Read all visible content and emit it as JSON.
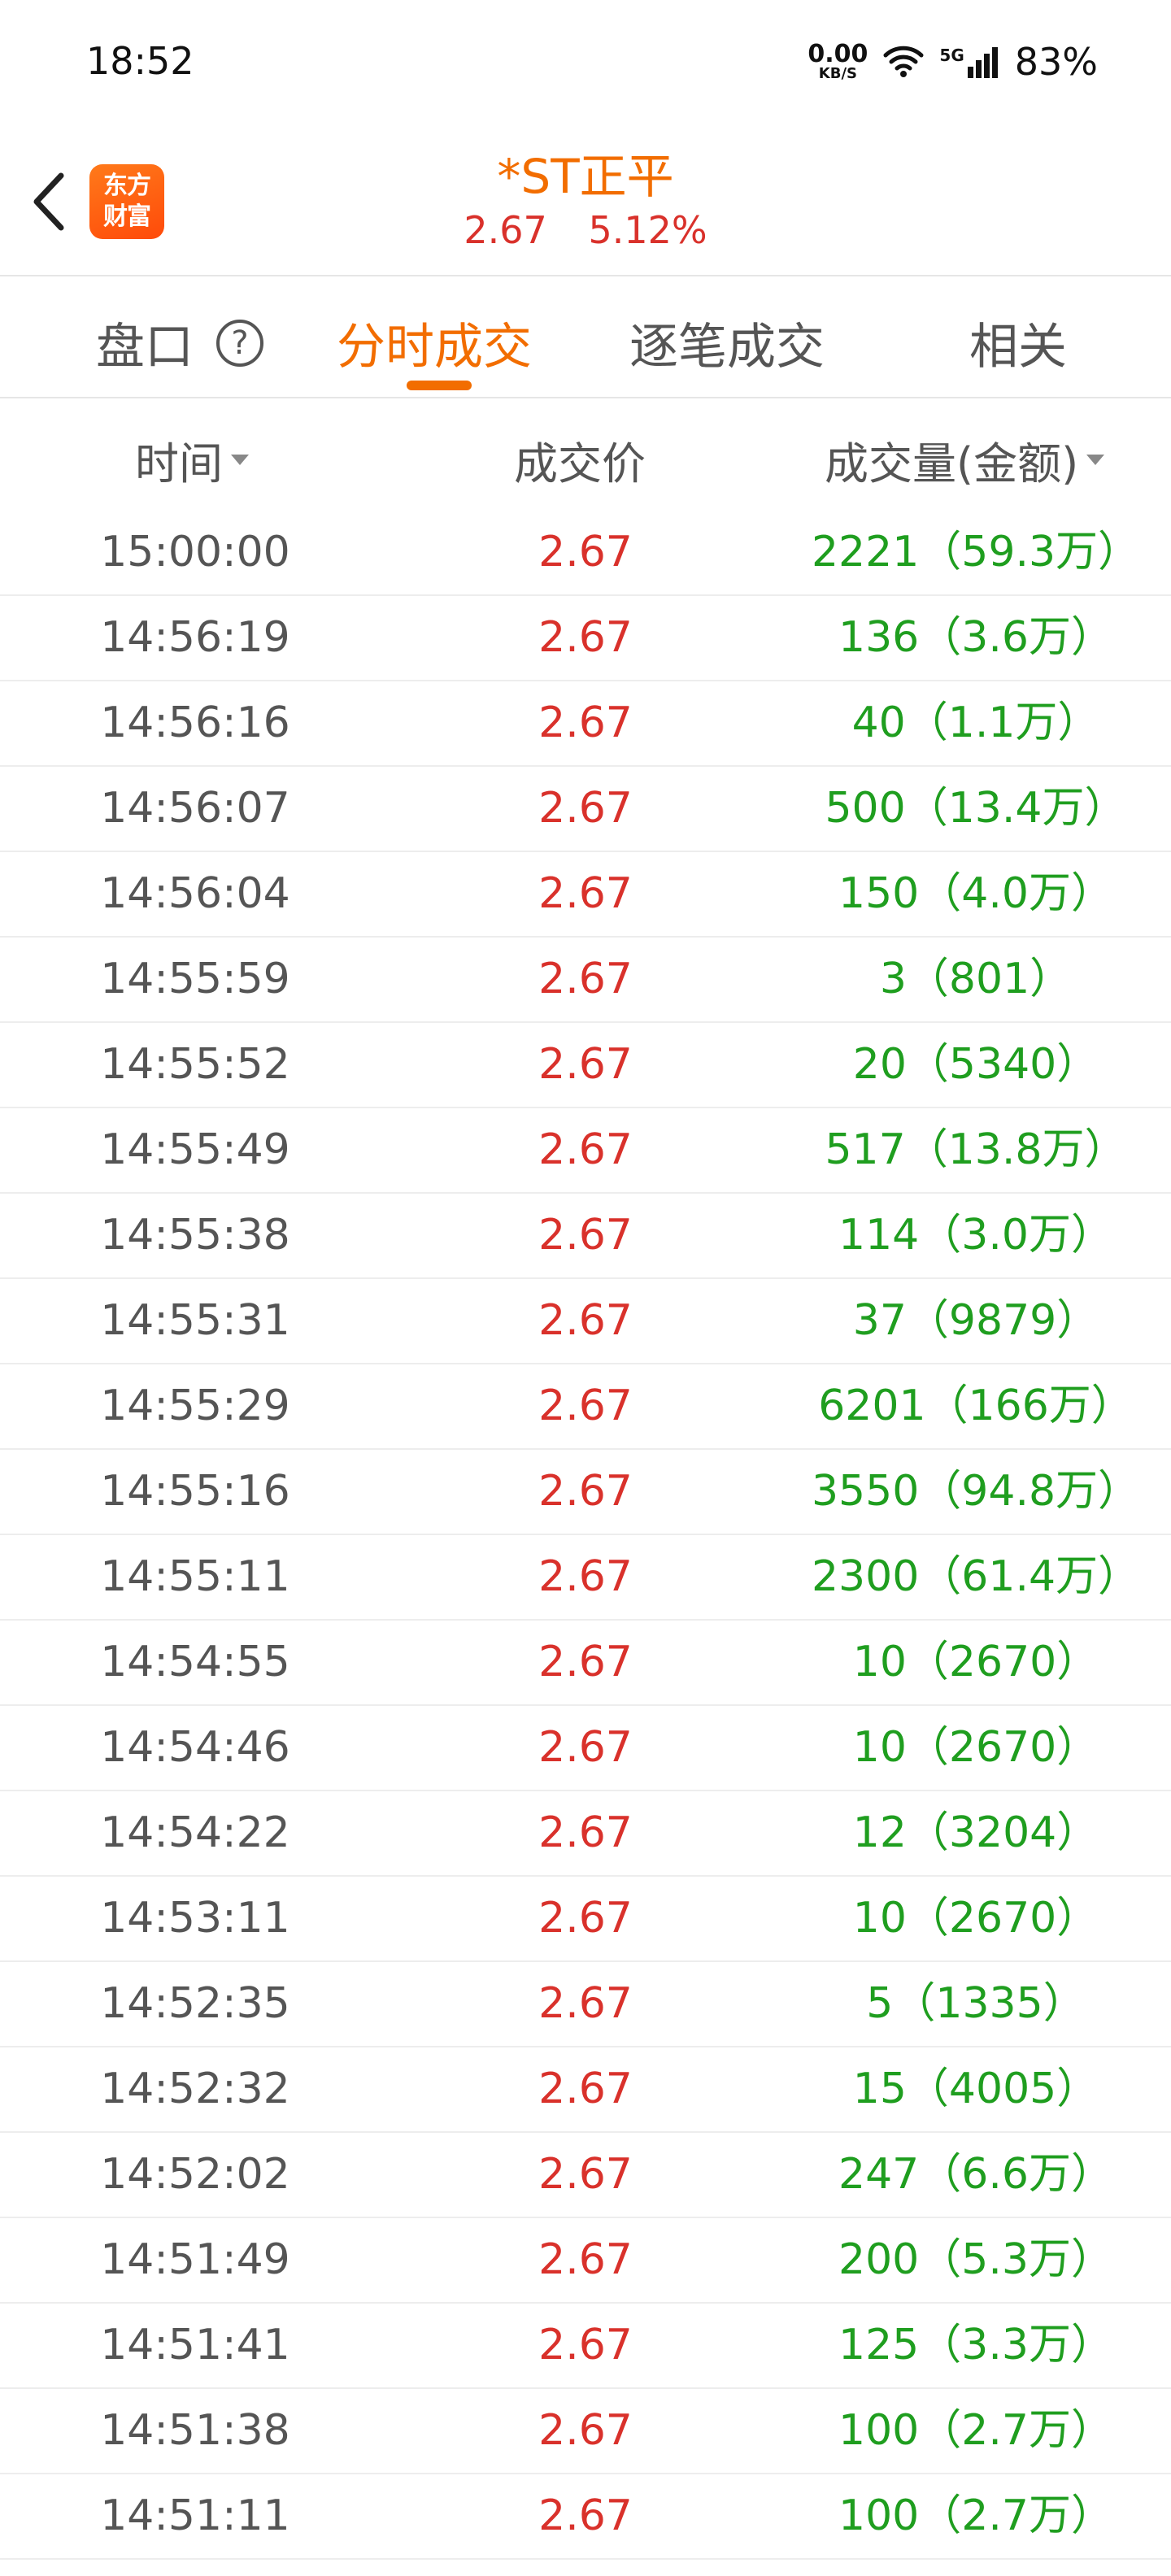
{
  "status_bar": {
    "time": "18:52",
    "net_speed_value": "0.00",
    "net_speed_unit": "KB/S",
    "signal_label": "5G",
    "battery": "83%"
  },
  "header": {
    "logo_line1": "东方",
    "logo_line2": "财富",
    "title": "*ST正平",
    "price": "2.67",
    "change_pct": "5.12%"
  },
  "tabs": [
    {
      "label": "盘口",
      "active": false
    },
    {
      "label": "分时成交",
      "active": true
    },
    {
      "label": "逐笔成交",
      "active": false
    },
    {
      "label": "相关",
      "active": false
    }
  ],
  "table": {
    "headers": {
      "time": "时间",
      "price": "成交价",
      "volume": "成交量(金额)"
    },
    "rows": [
      {
        "time": "15:00:00",
        "price": "2.67",
        "volume": "2221（59.3万）"
      },
      {
        "time": "14:56:19",
        "price": "2.67",
        "volume": "136（3.6万）"
      },
      {
        "time": "14:56:16",
        "price": "2.67",
        "volume": "40（1.1万）"
      },
      {
        "time": "14:56:07",
        "price": "2.67",
        "volume": "500（13.4万）"
      },
      {
        "time": "14:56:04",
        "price": "2.67",
        "volume": "150（4.0万）"
      },
      {
        "time": "14:55:59",
        "price": "2.67",
        "volume": "3（801）"
      },
      {
        "time": "14:55:52",
        "price": "2.67",
        "volume": "20（5340）"
      },
      {
        "time": "14:55:49",
        "price": "2.67",
        "volume": "517（13.8万）"
      },
      {
        "time": "14:55:38",
        "price": "2.67",
        "volume": "114（3.0万）"
      },
      {
        "time": "14:55:31",
        "price": "2.67",
        "volume": "37（9879）"
      },
      {
        "time": "14:55:29",
        "price": "2.67",
        "volume": "6201（166万）"
      },
      {
        "time": "14:55:16",
        "price": "2.67",
        "volume": "3550（94.8万）"
      },
      {
        "time": "14:55:11",
        "price": "2.67",
        "volume": "2300（61.4万）"
      },
      {
        "time": "14:54:55",
        "price": "2.67",
        "volume": "10（2670）"
      },
      {
        "time": "14:54:46",
        "price": "2.67",
        "volume": "10（2670）"
      },
      {
        "time": "14:54:22",
        "price": "2.67",
        "volume": "12（3204）"
      },
      {
        "time": "14:53:11",
        "price": "2.67",
        "volume": "10（2670）"
      },
      {
        "time": "14:52:35",
        "price": "2.67",
        "volume": "5（1335）"
      },
      {
        "time": "14:52:32",
        "price": "2.67",
        "volume": "15（4005）"
      },
      {
        "time": "14:52:02",
        "price": "2.67",
        "volume": "247（6.6万）"
      },
      {
        "time": "14:51:49",
        "price": "2.67",
        "volume": "200（5.3万）"
      },
      {
        "time": "14:51:41",
        "price": "2.67",
        "volume": "125（3.3万）"
      },
      {
        "time": "14:51:38",
        "price": "2.67",
        "volume": "100（2.7万）"
      },
      {
        "time": "14:51:11",
        "price": "2.67",
        "volume": "100（2.7万）"
      }
    ]
  },
  "colors": {
    "accent": "#f26d00",
    "up_red": "#d9312b",
    "volume_green": "#1f9e1f"
  }
}
